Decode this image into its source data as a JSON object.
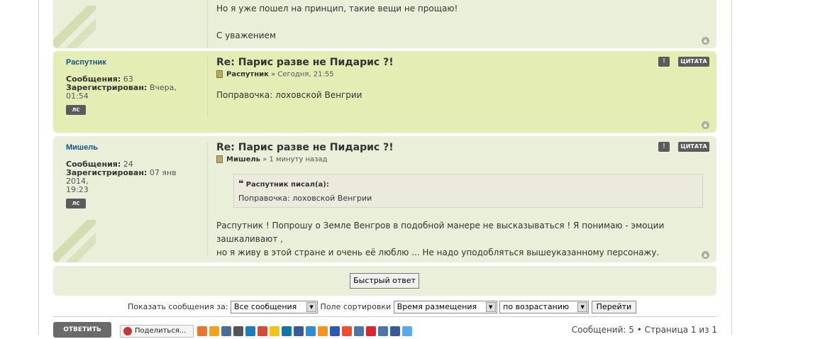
{
  "top_post": {
    "line1": "Но я уже пошел на принцип, такие вещи не прощаю!",
    "line2": "С уважением"
  },
  "posts": [
    {
      "username": "Распутник",
      "posts_label": "Сообщения:",
      "posts_count": "63",
      "registered_label": "Зарегистрирован:",
      "registered": "Вчера, 01:54",
      "pm_label": "ЛС",
      "title": "Re: Парис разве не Пидарис ?!",
      "author": "Распутник",
      "date": "» Сегодня, 21:55",
      "content": "Поправочка: лоховской Венгрии",
      "warn_label": "!",
      "quote_label": "ЦИТАТА"
    },
    {
      "username": "Мишель",
      "posts_label": "Сообщения:",
      "posts_count": "24",
      "registered_label": "Зарегистрирован:",
      "registered": "07 янв 2014,",
      "registered2": "19:23",
      "pm_label": "ЛС",
      "title": "Re: Парис разве не Пидарис ?!",
      "author": "Мишель",
      "date": "» 1 минуту назад",
      "quote_cite": "Распутник писал(а):",
      "quote_text": "Поправочка: лоховской Венгрии",
      "content_line1": "Распутник ! Попрошу о Земле Венгров в подобной манере не высказываться ! Я понимаю - эмоции зашкаливают ,",
      "content_line2": "но я живу в этой стране и очень её люблю ... Не надо уподобляться вышеуказанному персонажу.",
      "warn_label": "!",
      "quote_label": "ЦИТАТА"
    }
  ],
  "quick_reply": "Быстрый ответ",
  "sort": {
    "show_label": "Показать сообщения за:",
    "show_value": "Все сообщения",
    "sort_label": "Поле сортировки",
    "sort_value": "Время размещения",
    "order_value": "по возрастанию",
    "go_label": "Перейти"
  },
  "footer": {
    "reply_label": "ОТВЕТИТЬ",
    "share_label": "Поделиться...",
    "page_info": "Сообщений: 5 • Страница 1 из 1"
  },
  "social_colors": [
    "#e8772e",
    "#f4a21a",
    "#4a6c9b",
    "#555555",
    "#1a7dc0",
    "#d84a38",
    "#f0c419",
    "#0e76a8",
    "#3b5998",
    "#2c8fd6",
    "#f7931e",
    "#2a5ab5",
    "#ee4f2e",
    "#4a76a8",
    "#d8262c",
    "#4a76a8",
    "#3b5998",
    "#55acee"
  ]
}
